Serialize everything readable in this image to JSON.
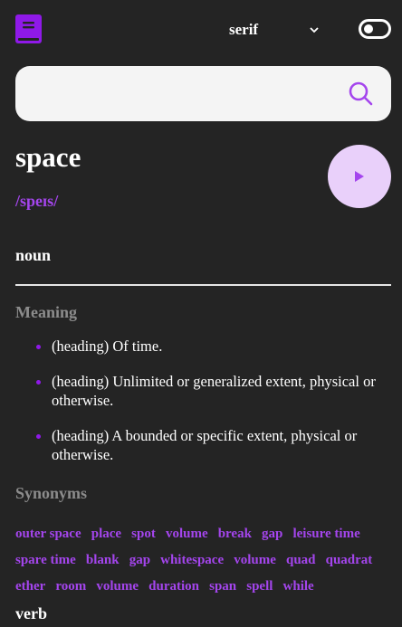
{
  "header": {
    "logo_icon": "book-icon",
    "font_select": {
      "value": "serif",
      "icon": "chevron-down-icon"
    },
    "theme_toggle": {
      "icon": "toggle-icon"
    }
  },
  "search": {
    "value": "",
    "icon": "search-icon"
  },
  "word": {
    "text": "space",
    "phonetic": "/speɪs/",
    "play_icon": "play-icon"
  },
  "meaning_block": {
    "part_of_speech": "noun",
    "meaning_label": "Meaning",
    "definitions": [
      "(heading) Of time.",
      "(heading) Unlimited or generalized extent, physical or otherwise.",
      "(heading) A bounded or specific extent, physical or otherwise."
    ],
    "synonyms_label": "Synonyms",
    "synonyms": [
      "outer space",
      "place",
      "spot",
      "volume",
      "break",
      "gap",
      "leisure time",
      "spare time",
      "blank",
      "gap",
      "whitespace",
      "volume",
      "quad",
      "quadrat",
      "ether",
      "room",
      "volume",
      "duration",
      "span",
      "spell",
      "while"
    ]
  },
  "next_block": {
    "part_of_speech": "verb"
  },
  "colors": {
    "background": "#242424",
    "accent": "#a445ed",
    "accent_light": "#e9d0fa",
    "muted": "#8c8c8c",
    "bullet": "#8f19e8"
  }
}
